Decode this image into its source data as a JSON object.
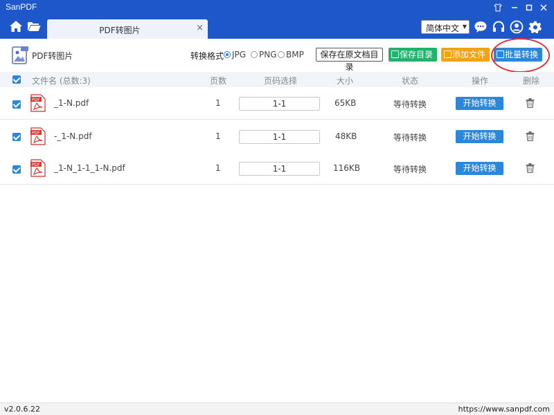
{
  "window": {
    "title": "SanPDF"
  },
  "nav": {
    "tab_label": "PDF转图片",
    "tab_close": "×",
    "language": "简体中文"
  },
  "toolbar": {
    "page_title": "PDF转图片",
    "format_label": "转换格式",
    "formats": [
      {
        "label": "JPG",
        "selected": true
      },
      {
        "label": "PNG",
        "selected": false
      },
      {
        "label": "BMP",
        "selected": false
      }
    ],
    "save_to_source_label": "保存在原文档目录",
    "save_dir_label": "保存目录",
    "add_file_label": "添加文件",
    "batch_convert_label": "批量转换"
  },
  "table": {
    "headers": {
      "filename": "文件名 (总数:3)",
      "pages": "页数",
      "page_select": "页码选择",
      "size": "大小",
      "status": "状态",
      "action": "操作",
      "delete": "删除"
    },
    "rows": [
      {
        "filename": "_1-N.pdf",
        "pages": "1",
        "range": "1-1",
        "size": "65KB",
        "status": "等待转换",
        "action": "开始转换"
      },
      {
        "filename": "-_1-N.pdf",
        "pages": "1",
        "range": "1-1",
        "size": "48KB",
        "status": "等待转换",
        "action": "开始转换"
      },
      {
        "filename": "_1-N_1-1_1-N.pdf",
        "pages": "1",
        "range": "1-1",
        "size": "116KB",
        "status": "等待转换",
        "action": "开始转换"
      }
    ]
  },
  "statusbar": {
    "version": "v2.0.6.22",
    "url": "https://www.sanpdf.com"
  },
  "colors": {
    "titlebar": "#1e57c9",
    "accent_blue": "#2b87d9",
    "green": "#23b26b",
    "orange": "#f5a114",
    "highlight_red": "#e53036"
  }
}
